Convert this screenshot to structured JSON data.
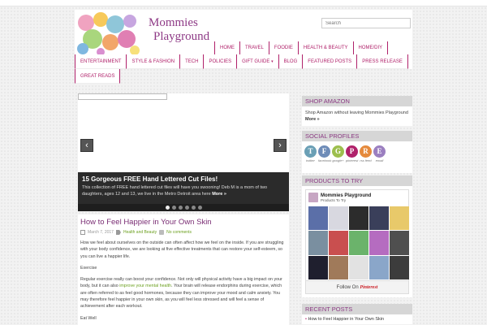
{
  "site": {
    "logo_line1": "Mommies",
    "logo_line2": "Playground",
    "search_placeholder": "Search"
  },
  "nav": {
    "row1": [
      "HOME",
      "TRAVEL",
      "FOODIE",
      "HEALTH & BEAUTY",
      "HOME/DIY"
    ],
    "row2": [
      "ENTERTAINMENT",
      "STYLE & FASHION",
      "TECH",
      "POLICIES",
      "GIFT GUIDE",
      "BLOG",
      "FEATURED POSTS",
      "PRESS RELEASE"
    ],
    "row3": [
      "GREAT READS"
    ],
    "dropdown_arrow": "▾"
  },
  "slider": {
    "prev_icon": "‹",
    "next_icon": "›",
    "title": "15 Gorgeous FREE Hand Lettered Cut Files!",
    "text": "This collection of FREE hand lettered cut files will have you swooning! Deb M is a mom of two daughters, ages 12 and 13, we live in the Metro Detroit area here",
    "more": "More »",
    "active_dot": 0
  },
  "post": {
    "title": "How to Feel Happier in Your Own Skin",
    "date": "March 7, 2017",
    "category": "Health and Beauty",
    "comments": "No comments",
    "p1": "How we feel about ourselves on the outside can often affect how we feel on the inside. If you are struggling with your body confidence, we are looking at five effective treatments that can restore your self-esteem, so you can live a happier life.",
    "p2": "Exercise",
    "p3_before": "Regular exercise really can boost your confidence. Not only will physical activity have a big impact on your body, but it can also ",
    "p3_link": "improve your mental health",
    "p3_after": ". Your brain will release endorphins during exercise, which are often referred to as feel good hormones, because they can improve your mood and calm anxiety. You may therefore feel happier in your own skin, as you will feel less stressed and will feel a sense of achievement after each workout.",
    "p4": "Eat Well"
  },
  "sidebar": {
    "shop_title": "SHOP AMAZON",
    "shop_text": "Shop Amazon without leaving Mommies Playground",
    "shop_more": "More »",
    "social_title": "SOCIAL PROFILES",
    "social": [
      {
        "letter": "T",
        "label": "twitter",
        "color": "#6a9fb5"
      },
      {
        "letter": "F",
        "label": "facebook",
        "color": "#6e8cb8"
      },
      {
        "letter": "G",
        "label": "google+",
        "color": "#9dbf4e"
      },
      {
        "letter": "P",
        "label": "pinterest",
        "color": "#b0216a"
      },
      {
        "letter": "R",
        "label": "rss feed",
        "color": "#e58a3c"
      },
      {
        "letter": "E",
        "label": "email",
        "color": "#9b7fc0"
      }
    ],
    "products_title": "PRODUCTS TO TRY",
    "pin_name": "Mommies Playground",
    "pin_sub": "Products To Try",
    "pin_follow": "Follow On",
    "pin_brand": "Pinterest",
    "recent_title": "RECENT POSTS",
    "recent_item": "How to Feel Happier in Your Own Skin"
  },
  "colors": {
    "accent": "#b0216a",
    "title": "#7a2d74",
    "link_green": "#6a9f1d"
  }
}
